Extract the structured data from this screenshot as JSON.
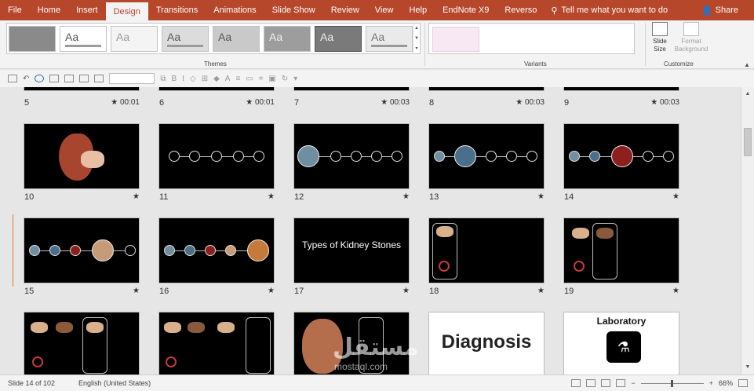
{
  "tabs": [
    "File",
    "Home",
    "Insert",
    "Design",
    "Transitions",
    "Animations",
    "Slide Show",
    "Review",
    "View",
    "Help",
    "EndNote X9",
    "Reverso"
  ],
  "active_tab": "Design",
  "tell_me": "Tell me what you want to do",
  "share": "Share",
  "ribbon": {
    "themes_label": "Themes",
    "variants_label": "Variants",
    "customize_label": "Customize",
    "slide_size": "Slide Size",
    "format_background": "Format Background",
    "theme_sample_text": "Aa"
  },
  "top_row": [
    {
      "num": "5",
      "time": "★ 00:01"
    },
    {
      "num": "6",
      "time": "★ 00:01"
    },
    {
      "num": "7",
      "time": "★ 00:03"
    },
    {
      "num": "8",
      "time": "★ 00:03"
    },
    {
      "num": "9",
      "time": "★ 00:03"
    }
  ],
  "slides": {
    "s10": {
      "num": "10",
      "meta": "★"
    },
    "s11": {
      "num": "11",
      "meta": "★"
    },
    "s12": {
      "num": "12",
      "meta": "★"
    },
    "s13": {
      "num": "13",
      "meta": "★"
    },
    "s14": {
      "num": "14",
      "meta": "★"
    },
    "s15": {
      "num": "15",
      "meta": "★"
    },
    "s16": {
      "num": "16",
      "meta": "★"
    },
    "s17": {
      "num": "17",
      "meta": "★",
      "title": "Types of Kidney Stones"
    },
    "s18": {
      "num": "18",
      "meta": "★"
    },
    "s19": {
      "num": "19",
      "meta": "★"
    },
    "s22": {
      "title": "Diagnosis"
    },
    "s23": {
      "title": "Laboratory"
    }
  },
  "status": {
    "slide_info": "Slide 14 of 102",
    "language": "English (United States)",
    "zoom": "66%"
  },
  "watermark": {
    "arabic": "مستقل",
    "latin": "mostaql.com"
  },
  "colors": {
    "accent": "#b7472a",
    "ribbon": "#f3f3f3",
    "sorter_bg": "#e6e6e6"
  }
}
